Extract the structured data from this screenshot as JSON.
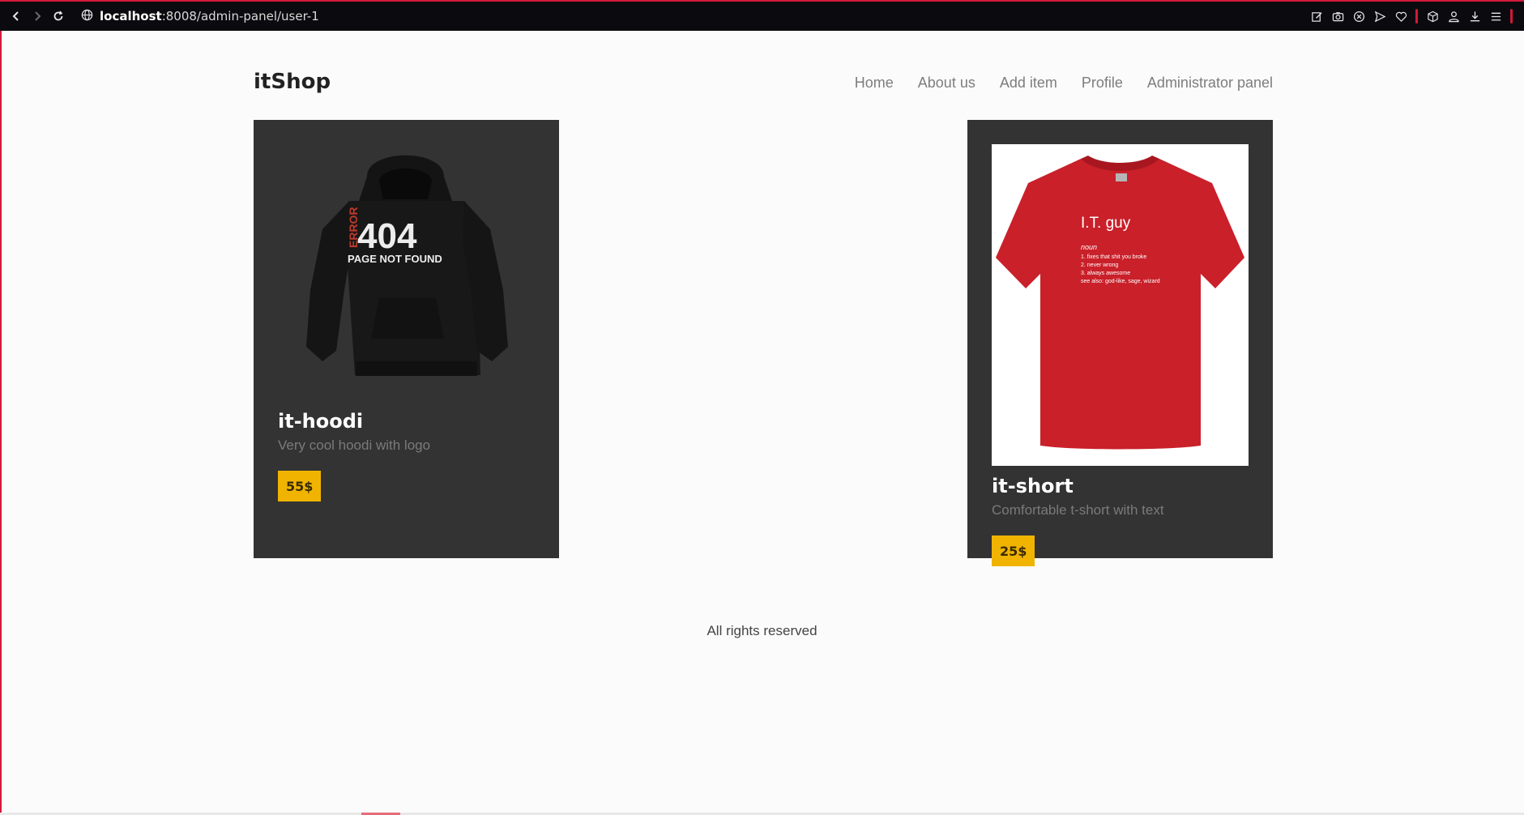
{
  "browser": {
    "url_host": "localhost",
    "url_path": ":8008/admin-panel/user-1",
    "icons": [
      "back-icon",
      "forward-icon",
      "reload-icon",
      "globe-icon",
      "edit-icon",
      "camera-icon",
      "shield-x-icon",
      "send-icon",
      "heart-icon",
      "cube-icon",
      "account-icon",
      "download-icon",
      "menu-icon"
    ]
  },
  "header": {
    "logo": "itShop",
    "nav": [
      "Home",
      "About us",
      "Add item",
      "Profile",
      "Administrator panel"
    ]
  },
  "products": [
    {
      "title": "it-hoodi",
      "description": "Very cool hoodi with logo",
      "price": "55$",
      "image_text": {
        "big": "404",
        "side": "ERROR",
        "sub": "PAGE NOT FOUND"
      }
    },
    {
      "title": "it-short",
      "description": "Comfortable t-short with text",
      "price": "25$",
      "image_text": {
        "heading": "I.T. guy",
        "pos": "noun",
        "lines": [
          "1. fixes that shit you broke",
          "2. never wrong",
          "3. always awesome",
          "see also: god-like, sage, wizard"
        ]
      }
    }
  ],
  "footer": {
    "text": "All rights reserved"
  },
  "colors": {
    "accent": "#f0b400",
    "card_bg": "#333333",
    "browser_accent": "#d2193a"
  }
}
